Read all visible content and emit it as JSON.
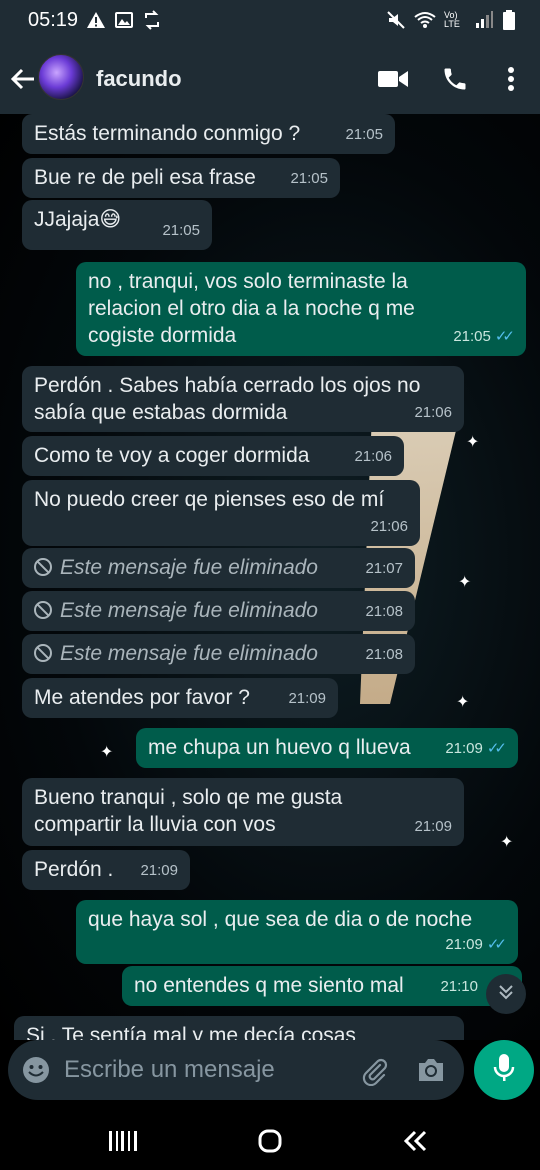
{
  "status_bar": {
    "time": "05:19",
    "lte_label": "Vo) LTE"
  },
  "header": {
    "contact_name": "facundo"
  },
  "messages": [
    {
      "dir": "in",
      "text": "Estás terminando conmigo ?",
      "time": "21:05"
    },
    {
      "dir": "in",
      "text": "Bue re de peli esa frase",
      "time": "21:05"
    },
    {
      "dir": "in",
      "text": "JJajaja😅",
      "time": "21:05"
    },
    {
      "dir": "out",
      "text": "no , tranqui, vos solo terminaste la\nrelacion el otro dia a la noche q me\ncogiste dormida",
      "time": "21:05",
      "read": true
    },
    {
      "dir": "in",
      "text": "Perdón . Sabes había cerrado los ojos no\nsabía que estabas dormida",
      "time": "21:06"
    },
    {
      "dir": "in",
      "text": "Como te voy a coger dormida",
      "time": "21:06"
    },
    {
      "dir": "in",
      "text": "No puedo creer qe pienses eso de mí",
      "time": "21:06"
    },
    {
      "dir": "in",
      "text": "Este mensaje fue eliminado",
      "time": "21:07",
      "deleted": true
    },
    {
      "dir": "in",
      "text": "Este mensaje fue eliminado",
      "time": "21:08",
      "deleted": true
    },
    {
      "dir": "in",
      "text": "Este mensaje fue eliminado",
      "time": "21:08",
      "deleted": true
    },
    {
      "dir": "in",
      "text": "Me atendes por favor ?",
      "time": "21:09"
    },
    {
      "dir": "out",
      "text": "me chupa un huevo q llueva",
      "time": "21:09",
      "read": true
    },
    {
      "dir": "in",
      "text": "Bueno tranqui , solo qe me gusta\ncompartir la lluvia con vos",
      "time": "21:09"
    },
    {
      "dir": "in",
      "text": "Perdón .",
      "time": "21:09"
    },
    {
      "dir": "out",
      "text": "que haya sol  , que sea de dia o de  noche",
      "time": "21:09",
      "read": true
    },
    {
      "dir": "out",
      "text": "no entendes q me siento mal",
      "time": "21:10",
      "read": false
    },
    {
      "dir": "in",
      "text": "Si . Te sentía mal y me decía cosas",
      "time": ""
    }
  ],
  "input": {
    "placeholder": "Escribe un mensaje"
  },
  "colors": {
    "header_bg": "#1f2c34",
    "incoming_bubble": "#1f2c34",
    "outgoing_bubble": "#005c4b",
    "accent": "#00a884",
    "read_tick": "#53bdeb"
  }
}
